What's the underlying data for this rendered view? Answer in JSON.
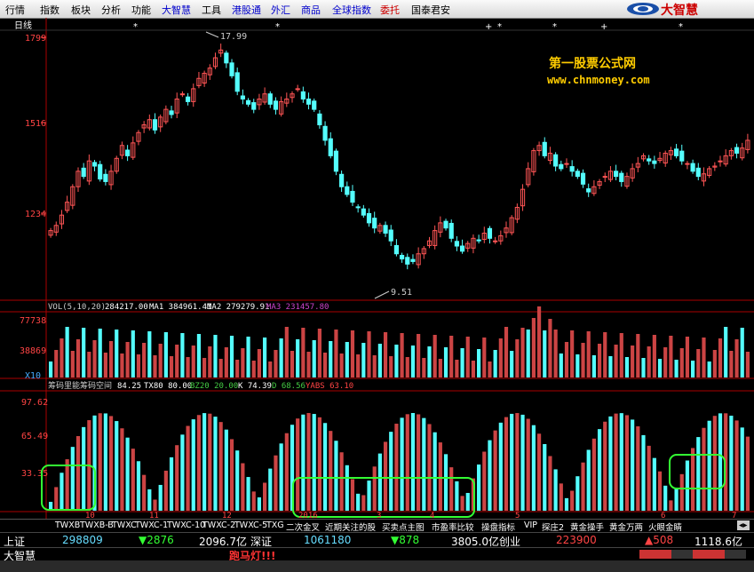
{
  "menubar": {
    "items": [
      "行情",
      "指数",
      "板块",
      "分析",
      "功能",
      "大智慧",
      "工具",
      "港股通",
      "外汇",
      "商品",
      "全球指数",
      "委托",
      "国泰君安"
    ],
    "logo": "大智慧"
  },
  "chart_header": {
    "period": "日线",
    "price_ticks": [
      "1799",
      "1516",
      "1234"
    ],
    "high_label": "17.99",
    "low_label": "9.51",
    "watermark_title": "第一股票公式网",
    "watermark_url": "www.chnmoney.com"
  },
  "volume_panel": {
    "title": "VOL(5,10,20)",
    "vol": "284217.00",
    "ma1": "MA1 384961.41",
    "ma2": "MA2 279279.91",
    "ma3": "MA3 231457.80",
    "ticks": [
      "77738",
      "38869"
    ],
    "unit": "X10"
  },
  "indicator_panel": {
    "title": "筹码里能筹码空间",
    "v1": "84.25",
    "v2": "TX80 80.00",
    "v3": "BZ20 20.00",
    "v4": "K 74.39",
    "v5": "D 68.56",
    "v6": "YABS 63.10",
    "ticks": [
      "97.62",
      "65.49",
      "33.35"
    ]
  },
  "time_axis": [
    "10",
    "11",
    "12",
    "2016",
    "3",
    "4",
    "5",
    "6",
    "7"
  ],
  "bottom_tabs": [
    "TWXB",
    "TWXB-B",
    "TWXC",
    "TWXC-1",
    "TWXC-10",
    "TWXC-2",
    "TWXC-5",
    "TXG",
    "二次金叉",
    "近期关注的股",
    "买卖点主图",
    "市盈率比较",
    "操盘指标",
    "VIP",
    "探庄2",
    "黄金操手",
    "黄金万两",
    "火眼金睛"
  ],
  "status": {
    "sh_name": "上证",
    "sh_index": "298809",
    "sh_change": "▼2876",
    "sh_amount": "2096.7亿",
    "sz_name": "深证",
    "sz_index": "1061180",
    "sz_change": "▼878",
    "sz_amount": "3805.0亿",
    "cy_name": "创业",
    "cy_index": "223900",
    "cy_change": "▲508",
    "cy_amount": "1118.6亿",
    "brand": "大智慧",
    "marquee": "跑马灯!!!"
  },
  "chart_data": {
    "type": "candlestick",
    "y_price_range": [
      820,
      1860
    ],
    "high": 17.99,
    "low": 9.51,
    "closes": [
      1090,
      1110,
      1150,
      1200,
      1260,
      1320,
      1300,
      1360,
      1340,
      1290,
      1280,
      1320,
      1370,
      1420,
      1380,
      1430,
      1470,
      1500,
      1520,
      1480,
      1530,
      1560,
      1540,
      1600,
      1620,
      1590,
      1640,
      1680,
      1700,
      1720,
      1760,
      1790,
      1740,
      1690,
      1630,
      1600,
      1580,
      1560,
      1600,
      1620,
      1580,
      1560,
      1590,
      1600,
      1620,
      1640,
      1600,
      1580,
      1560,
      1500,
      1440,
      1380,
      1320,
      1260,
      1230,
      1200,
      1180,
      1150,
      1120,
      1100,
      1110,
      1080,
      1050,
      1000,
      980,
      960,
      970,
      1000,
      1020,
      1050,
      1090,
      1120,
      1100,
      1060,
      1030,
      1010,
      1040,
      1060,
      1050,
      1080,
      1060,
      1050,
      1070,
      1100,
      1140,
      1180,
      1250,
      1330,
      1400,
      1420,
      1380,
      1390,
      1340,
      1330,
      1350,
      1320,
      1300,
      1270,
      1240,
      1260,
      1280,
      1300,
      1320,
      1300,
      1280,
      1300,
      1330,
      1350,
      1380,
      1360,
      1350,
      1370,
      1390,
      1400,
      1380,
      1360,
      1350,
      1320,
      1300,
      1310,
      1330,
      1340,
      1360,
      1380,
      1400,
      1390,
      1410,
      1440
    ]
  }
}
